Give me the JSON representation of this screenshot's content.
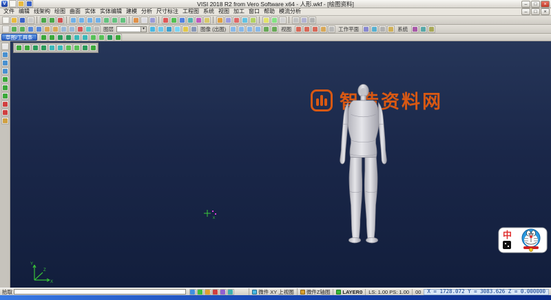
{
  "window": {
    "title": "VISI 2018 R2 from Vero Software x64 - 人形.wkf - [绘图资料]",
    "app_icon": "V",
    "controls": {
      "minimize": "–",
      "maximize": "□",
      "close": "×"
    },
    "mdi_controls": {
      "minimize": "–",
      "restore": "□",
      "close": "×"
    },
    "quick_icons": [
      {
        "n": "quick-new-icon",
        "c": "#f6f6f2"
      },
      {
        "n": "quick-open-icon",
        "c": "#e8b93e"
      },
      {
        "n": "quick-save-icon",
        "c": "#3a62c8"
      }
    ]
  },
  "menu": {
    "items": [
      "文件",
      "编辑",
      "线架构",
      "绘图",
      "曲面",
      "实体",
      "实体编辑",
      "建模",
      "分析",
      "尺寸标注",
      "工程图",
      "系统",
      "视图",
      "加工",
      "窗口",
      "帮助",
      "模流分析"
    ]
  },
  "toolbarA": {
    "icons": [
      {
        "n": "new-file-icon",
        "c": "#f6f6f2"
      },
      {
        "n": "open-file-icon",
        "c": "#e8b93e"
      },
      {
        "n": "save-icon",
        "c": "#3a62c8"
      },
      {
        "n": "print-icon",
        "c": "#c9c9c9"
      },
      {
        "n": "sep"
      },
      {
        "n": "undo-icon",
        "c": "#4aa84a"
      },
      {
        "n": "redo-icon",
        "c": "#4aa84a"
      },
      {
        "n": "delete-icon",
        "c": "#d05050"
      },
      {
        "n": "sep"
      },
      {
        "n": "zoom-all-icon",
        "c": "#6fb0e8"
      },
      {
        "n": "zoom-window-icon",
        "c": "#6fb0e8"
      },
      {
        "n": "zoom-in-icon",
        "c": "#6fb0e8"
      },
      {
        "n": "zoom-out-icon",
        "c": "#6fb0e8"
      },
      {
        "n": "pan-view-icon",
        "c": "#62c27e"
      },
      {
        "n": "rotate-view-icon",
        "c": "#62c27e"
      },
      {
        "n": "previous-view-icon",
        "c": "#62c27e"
      },
      {
        "n": "sep"
      },
      {
        "n": "shaded-view-icon",
        "c": "#e09048"
      },
      {
        "n": "wireframe-view-icon",
        "c": "#dddde4"
      },
      {
        "n": "hidden-line-icon",
        "c": "#9a9ad6"
      },
      {
        "n": "sep"
      },
      {
        "n": "point-icon",
        "c": "#e05858"
      },
      {
        "n": "line-icon",
        "c": "#52c052"
      },
      {
        "n": "circle-icon",
        "c": "#5382e2"
      },
      {
        "n": "arc-icon",
        "c": "#52b2b2"
      },
      {
        "n": "spline-icon",
        "c": "#c058c0"
      },
      {
        "n": "rectangle-icon",
        "c": "#d8c868"
      },
      {
        "n": "sep"
      },
      {
        "n": "surface-icon",
        "c": "#e0a040"
      },
      {
        "n": "solid-block-icon",
        "c": "#9a9ae0"
      },
      {
        "n": "boolean-icon",
        "c": "#e06868"
      },
      {
        "n": "fillet-icon",
        "c": "#62c2e2"
      },
      {
        "n": "chamfer-icon",
        "c": "#b2d262"
      },
      {
        "n": "sep"
      },
      {
        "n": "measure-icon",
        "c": "#e2e268"
      },
      {
        "n": "dimension-icon",
        "c": "#84e284"
      },
      {
        "n": "text-icon",
        "c": "#d2d2d2"
      },
      {
        "n": "sep"
      },
      {
        "n": "layer-manager-icon",
        "c": "#c2c2c2"
      },
      {
        "n": "attributes-icon",
        "c": "#b2b2d2"
      },
      {
        "n": "options-icon",
        "c": "#b2b2b2"
      }
    ]
  },
  "toolbarB": {
    "labels": {
      "layer": "图层",
      "image": "图像 (出图)",
      "view": "视图",
      "workplane": "工作平面",
      "system": "系统"
    },
    "layer_selected": "",
    "cluster0": [
      {
        "n": "select-icon",
        "c": "#e6e6e6"
      },
      {
        "n": "select-chain-icon",
        "c": "#58b058"
      },
      {
        "n": "select-box-icon",
        "c": "#58b058"
      },
      {
        "n": "filter-icon",
        "c": "#5888d8"
      },
      {
        "n": "mask-icon",
        "c": "#5888d8"
      },
      {
        "n": "group-icon",
        "c": "#d8a858"
      },
      {
        "n": "ungroup-icon",
        "c": "#d8a858"
      },
      {
        "n": "blank-icon",
        "c": "#9ab8d8"
      },
      {
        "n": "unblank-icon",
        "c": "#9ab8d8"
      },
      {
        "n": "color-icon",
        "c": "#d85858"
      },
      {
        "n": "linetype-icon",
        "c": "#58c8c8"
      },
      {
        "n": "thickness-icon",
        "c": "#b8b8b8"
      }
    ],
    "cluster1": [
      {
        "n": "render-shaded-icon",
        "c": "#4ab8e2"
      },
      {
        "n": "render-wire-icon",
        "c": "#6ac8ee"
      },
      {
        "n": "render-hidden-icon",
        "c": "#3aa0d0"
      },
      {
        "n": "render-transparent-icon",
        "c": "#7ad4f4"
      },
      {
        "n": "light-icon",
        "c": "#e2c84a"
      },
      {
        "n": "background-icon",
        "c": "#8898b8"
      }
    ],
    "cluster2": [
      {
        "n": "view-top-icon",
        "c": "#88b8e8"
      },
      {
        "n": "view-front-icon",
        "c": "#88b8e8"
      },
      {
        "n": "view-side-icon",
        "c": "#88b8e8"
      },
      {
        "n": "view-iso-icon",
        "c": "#88b8e8"
      },
      {
        "n": "view-dynamic-icon",
        "c": "#68a858"
      },
      {
        "n": "view-previous-icon",
        "c": "#68a858"
      }
    ],
    "cluster3": [
      {
        "n": "workplane-xy-icon",
        "c": "#d86858"
      },
      {
        "n": "workplane-xz-icon",
        "c": "#d86858"
      },
      {
        "n": "workplane-yz-icon",
        "c": "#d86858"
      },
      {
        "n": "workplane-3points-icon",
        "c": "#d8a858"
      },
      {
        "n": "workplane-reset-icon",
        "c": "#b8b8b8"
      }
    ],
    "cluster4": [
      {
        "n": "system-settings-icon",
        "c": "#8888d0"
      },
      {
        "n": "system-info-icon",
        "c": "#58b0d0"
      },
      {
        "n": "calculator-icon",
        "c": "#b0b0b0"
      },
      {
        "n": "help-icon",
        "c": "#d0b058"
      }
    ],
    "cluster5": [
      {
        "n": "macro-icon",
        "c": "#a858a8"
      },
      {
        "n": "plugin-icon",
        "c": "#58a8a8"
      },
      {
        "n": "update-icon",
        "c": "#a8a858"
      }
    ]
  },
  "toolbarC": {
    "tab": "草图/工具条",
    "icons": [
      {
        "n": "sketch-line-icon",
        "c": "#3aa83a"
      },
      {
        "n": "sketch-arc-icon",
        "c": "#3aa83a"
      },
      {
        "n": "sketch-circle-icon",
        "c": "#2a9a5a"
      },
      {
        "n": "sketch-rect-icon",
        "c": "#2a9a5a"
      },
      {
        "n": "sketch-point-icon",
        "c": "#3ab8b8"
      },
      {
        "n": "sketch-trim-icon",
        "c": "#3ab8b8"
      },
      {
        "n": "sketch-offset-icon",
        "c": "#58c058"
      },
      {
        "n": "sketch-mirror-icon",
        "c": "#58c058"
      },
      {
        "n": "sketch-fillet-icon",
        "c": "#2a9a5a"
      },
      {
        "n": "sketch-dimension-icon",
        "c": "#3aa83a"
      }
    ]
  },
  "leftDock": {
    "icons": [
      {
        "n": "select-arrow-icon",
        "c": "#e8e8e8"
      },
      {
        "n": "pan-icon",
        "c": "#4890d0"
      },
      {
        "n": "zoom-icon",
        "c": "#4890d0"
      },
      {
        "n": "rotate-icon",
        "c": "#4890d0"
      },
      {
        "n": "wireframe-mode-icon",
        "c": "#3aa83a"
      },
      {
        "n": "shaded-mode-icon",
        "c": "#3aa83a"
      },
      {
        "n": "dynamic-view-icon",
        "c": "#3aa83a"
      },
      {
        "n": "measure-tool-icon",
        "c": "#d04040"
      },
      {
        "n": "erase-icon",
        "c": "#d04040"
      },
      {
        "n": "properties-icon",
        "c": "#d0a040"
      }
    ]
  },
  "miniPalette": {
    "icons": [
      {
        "n": "grid-icon",
        "c": "#3aa83a"
      },
      {
        "n": "snap-icon",
        "c": "#3aa83a"
      },
      {
        "n": "axis-icon",
        "c": "#2a9a5a"
      },
      {
        "n": "plane-icon",
        "c": "#2a9a5a"
      },
      {
        "n": "ucs-icon",
        "c": "#3ab8b8"
      },
      {
        "n": "origin-icon",
        "c": "#3ab8b8"
      },
      {
        "n": "ruler-icon",
        "c": "#58c058"
      },
      {
        "n": "guides-icon",
        "c": "#58c058"
      },
      {
        "n": "lock-icon",
        "c": "#2a9a5a"
      },
      {
        "n": "target-icon",
        "c": "#3aa83a"
      }
    ]
  },
  "viewport": {
    "watermark": {
      "text": "智造资料网",
      "color": "#e65c0f"
    },
    "triad": {
      "x": "X",
      "y": "Y",
      "z": "Z"
    },
    "sticker": {
      "badge": "中"
    }
  },
  "statusbar": {
    "prompt": "拾取",
    "input_value": "",
    "icons": [
      {
        "n": "snap-settings-icon",
        "c": "#4090e0"
      },
      {
        "n": "grid-snap-icon",
        "c": "#40c040"
      },
      {
        "n": "ortho-icon",
        "c": "#e0a030"
      },
      {
        "n": "wcs-icon",
        "c": "#d04040"
      },
      {
        "n": "selection-filter-icon",
        "c": "#9060d0"
      },
      {
        "n": "magnet-icon",
        "c": "#40b0b0"
      }
    ],
    "workplane": "微件 XY 上视图",
    "axis_view": "微件Z轴图",
    "layer": "LAYER0",
    "scales": "LS: 1.00  PS: 1.00",
    "pen_width": "00",
    "coords": "X = 1728.072  Y = 3083.626  Z = 0.000000"
  }
}
